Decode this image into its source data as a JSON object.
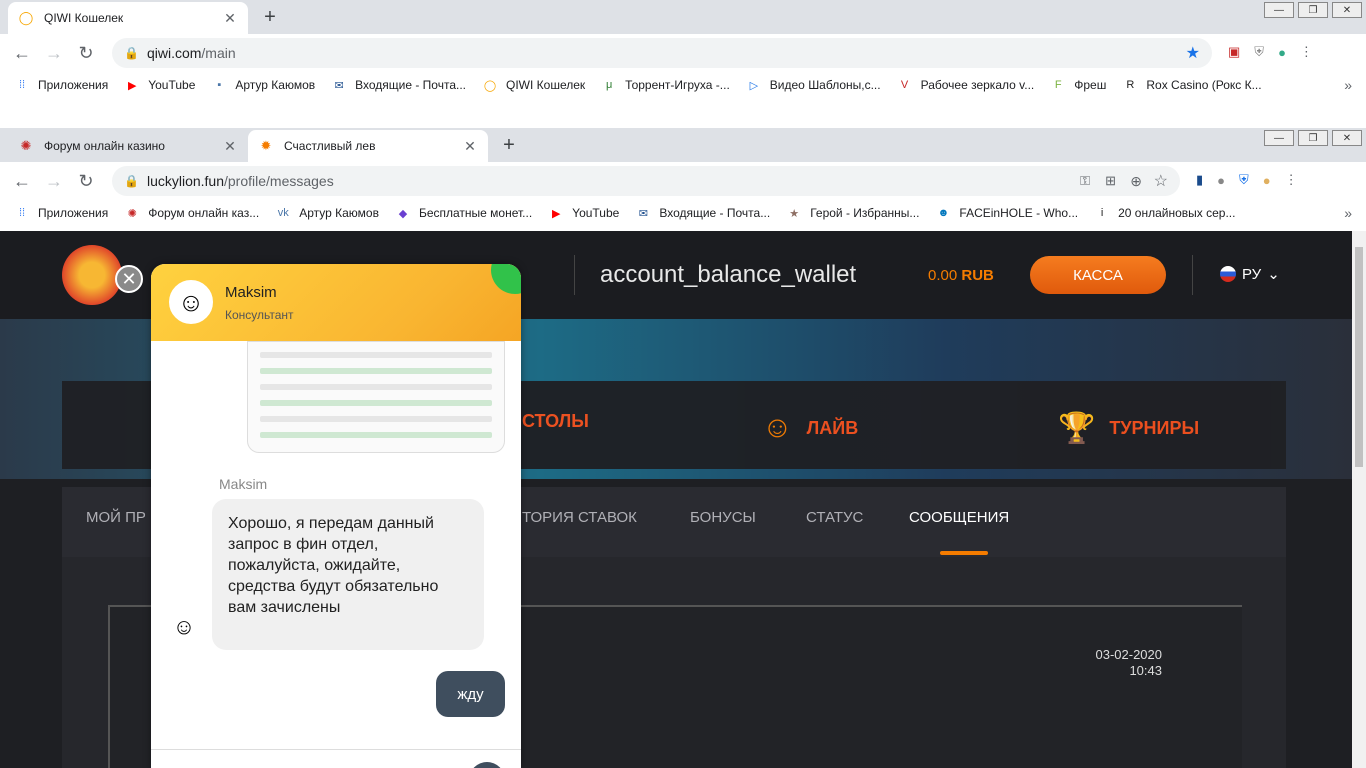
{
  "window1": {
    "tabs": [
      {
        "title": "QIWI Кошелек",
        "close": "✕"
      }
    ],
    "new_tab": "+",
    "url_host": "qiwi.com",
    "url_path": "/main",
    "bookmarks": [
      {
        "label": "Приложения",
        "icon": "apps-grid-icon"
      },
      {
        "label": "YouTube",
        "icon": "youtube-icon"
      },
      {
        "label": "Артур Каюмов",
        "icon": "chat-icon"
      },
      {
        "label": "Входящие - Почта...",
        "icon": "mail-icon"
      },
      {
        "label": "QIWI Кошелек",
        "icon": "qiwi-icon"
      },
      {
        "label": "Торрент-Игруха -...",
        "icon": "torrent-icon"
      },
      {
        "label": "Видео Шаблоны,с...",
        "icon": "play-icon"
      },
      {
        "label": "Рабочее зеркало v...",
        "icon": "v-icon"
      },
      {
        "label": "Фреш",
        "icon": "fresh-icon"
      },
      {
        "label": "Rox Casino (Рокс К...",
        "icon": "rox-icon"
      }
    ]
  },
  "window2": {
    "tabs": [
      {
        "title": "Форум онлайн казино",
        "close": "✕"
      },
      {
        "title": "Счастливый лев",
        "close": "✕"
      }
    ],
    "new_tab": "+",
    "url_host": "luckylion.fun",
    "url_path": "/profile/messages",
    "bookmarks": [
      {
        "label": "Приложения",
        "icon": "apps-grid-icon"
      },
      {
        "label": "Форум онлайн каз...",
        "icon": "casino-chip-icon"
      },
      {
        "label": "Артур Каюмов",
        "icon": "vk-icon"
      },
      {
        "label": "Бесплатные монет...",
        "icon": "coin-icon"
      },
      {
        "label": "YouTube",
        "icon": "youtube-icon"
      },
      {
        "label": "Входящие - Почта...",
        "icon": "mail-icon"
      },
      {
        "label": "Герой - Избранны...",
        "icon": "star-icon"
      },
      {
        "label": "FACEinHOLE - Who...",
        "icon": "face-icon"
      },
      {
        "label": "20 онлайновых сер...",
        "icon": "itc-icon"
      }
    ]
  },
  "site": {
    "balance_label": "account_balance_wallet",
    "balance_amount": "0.00",
    "balance_currency": "RUB",
    "cashier_button": "КАССА",
    "language": "РУ",
    "nav": [
      "СТОЛЫ",
      "ЛАЙВ",
      "ТУРНИРЫ"
    ],
    "profile_tabs": [
      "МОЙ ПР",
      "ТОРИЯ СТАВОК",
      "БОНУСЫ",
      "СТАТУС",
      "СООБЩЕНИЯ"
    ],
    "active_tab": "СООБЩЕНИЯ",
    "message_date": "03-02-2020",
    "message_time": "10:43",
    "accent": "#f57c00"
  },
  "chat": {
    "agent_name": "Maksim",
    "agent_role": "Консультант",
    "sender": "Maksim",
    "incoming_text": "Хорошо, я передам данный запрос в фин отдел, пожалуйста, ожидайте, средства будут обязательно вам зачислены",
    "outgoing_text": "жду",
    "close": "✕"
  }
}
